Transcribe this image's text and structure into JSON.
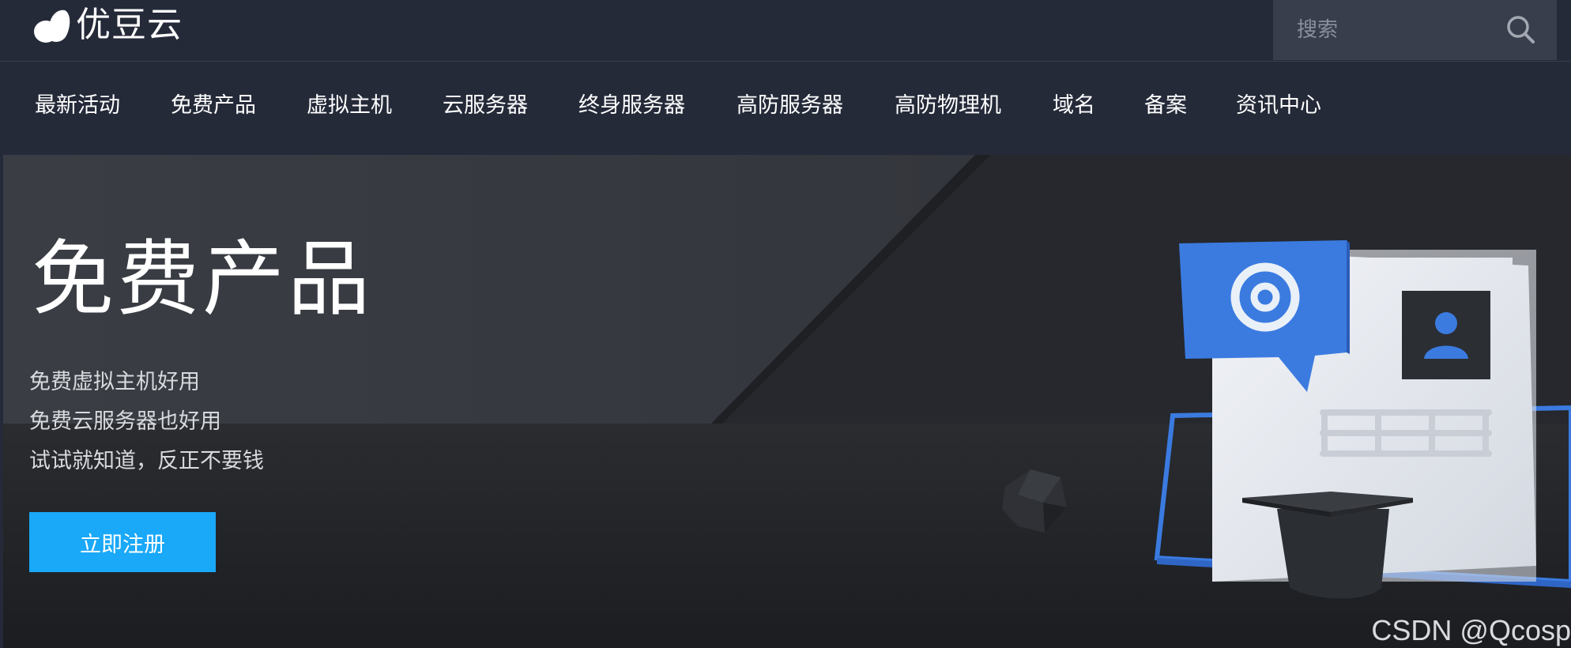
{
  "header": {
    "logo_text": "优豆云",
    "search": {
      "placeholder": "搜索",
      "value": ""
    }
  },
  "nav": {
    "items": [
      {
        "label": "最新活动"
      },
      {
        "label": "免费产品"
      },
      {
        "label": "虚拟主机"
      },
      {
        "label": "云服务器"
      },
      {
        "label": "终身服务器"
      },
      {
        "label": "高防服务器"
      },
      {
        "label": "高防物理机"
      },
      {
        "label": "域名"
      },
      {
        "label": "备案"
      },
      {
        "label": "资讯中心"
      }
    ]
  },
  "hero": {
    "title": "免费产品",
    "lines": [
      "免费虚拟主机好用",
      "免费云服务器也好用",
      "试试就知道，反正不要钱"
    ],
    "cta_label": "立即注册",
    "illustration_icons": [
      "at-sign-icon",
      "user-avatar-icon",
      "graduation-cap-icon"
    ]
  },
  "watermark": "CSDN @Qcosp",
  "colors": {
    "header_bg": "#252a39",
    "search_bg": "#393e4d",
    "hero_bg": "#2a2d33",
    "cta": "#1aa8f8",
    "accent_blue": "#3b7be0"
  }
}
